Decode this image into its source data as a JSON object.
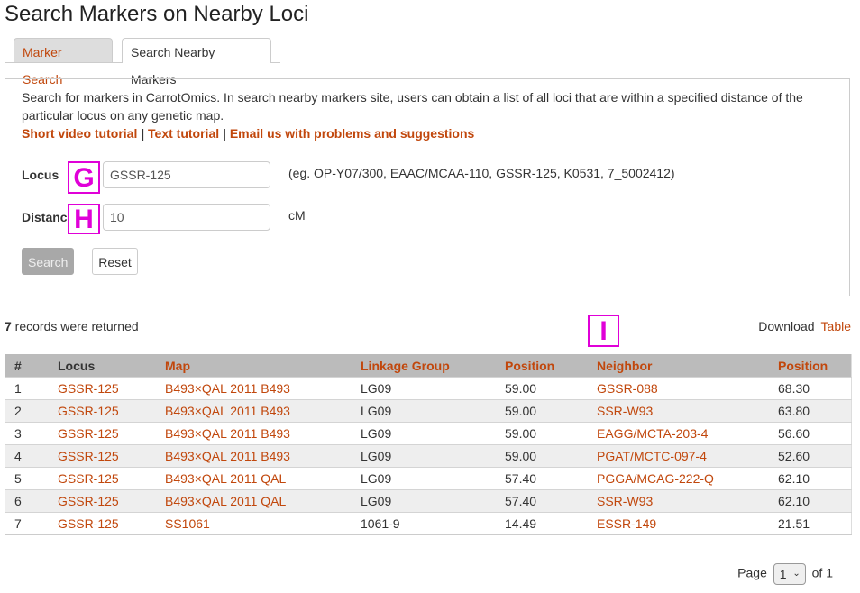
{
  "page": {
    "title": "Search Markers on Nearby Loci"
  },
  "tabs": [
    {
      "label": "Marker Search",
      "active": false
    },
    {
      "label": "Search Nearby Markers",
      "active": true
    }
  ],
  "description": {
    "text": "Search for markers in CarrotOmics. In search nearby markers site, users can obtain a list of all loci that are within a specified distance of the particular locus on any genetic map.",
    "links": [
      {
        "label": "Short video tutorial"
      },
      {
        "label": "Text tutorial"
      },
      {
        "label": "Email us with problems and suggestions"
      }
    ],
    "separator": "|"
  },
  "form": {
    "locus": {
      "label": "Locus",
      "value": "GSSR-125",
      "hint": "(eg. OP-Y07/300, EAAC/MCAA-110, GSSR-125, K0531, 7_5002412)",
      "marker": "G"
    },
    "distance": {
      "label": "Distanc",
      "value": "10",
      "unit": "cM",
      "marker": "H"
    },
    "search_label": "Search",
    "reset_label": "Reset"
  },
  "results": {
    "count": "7",
    "count_suffix": " records were returned",
    "download_label": "Download",
    "download_link": "Table",
    "marker": "I",
    "columns": [
      "#",
      "Locus",
      "Map",
      "Linkage Group",
      "Position",
      "Neighbor",
      "Position"
    ],
    "rows": [
      {
        "num": "1",
        "locus": "GSSR-125",
        "map": "B493×QAL 2011 B493",
        "lg": "LG09",
        "pos": "59.00",
        "neighbor": "GSSR-088",
        "npos": "68.30"
      },
      {
        "num": "2",
        "locus": "GSSR-125",
        "map": "B493×QAL 2011 B493",
        "lg": "LG09",
        "pos": "59.00",
        "neighbor": "SSR-W93",
        "npos": "63.80"
      },
      {
        "num": "3",
        "locus": "GSSR-125",
        "map": "B493×QAL 2011 B493",
        "lg": "LG09",
        "pos": "59.00",
        "neighbor": "EAGG/MCTA-203-4",
        "npos": "56.60"
      },
      {
        "num": "4",
        "locus": "GSSR-125",
        "map": "B493×QAL 2011 B493",
        "lg": "LG09",
        "pos": "59.00",
        "neighbor": "PGAT/MCTC-097-4",
        "npos": "52.60"
      },
      {
        "num": "5",
        "locus": "GSSR-125",
        "map": "B493×QAL 2011 QAL",
        "lg": "LG09",
        "pos": "57.40",
        "neighbor": "PGGA/MCAG-222-Q",
        "npos": "62.10"
      },
      {
        "num": "6",
        "locus": "GSSR-125",
        "map": "B493×QAL 2011 QAL",
        "lg": "LG09",
        "pos": "57.40",
        "neighbor": "SSR-W93",
        "npos": "62.10"
      },
      {
        "num": "7",
        "locus": "GSSR-125",
        "map": "SS1061",
        "lg": "1061-9",
        "pos": "14.49",
        "neighbor": "ESSR-149",
        "npos": "21.51"
      }
    ]
  },
  "pager": {
    "page_label": "Page",
    "current": "1",
    "of_label": "of 1",
    "chevron_icon": "chevron-down-icon"
  },
  "colors": {
    "link": "#c1470c",
    "header_bg": "#bbbbbb",
    "marker": "#e000d8"
  }
}
